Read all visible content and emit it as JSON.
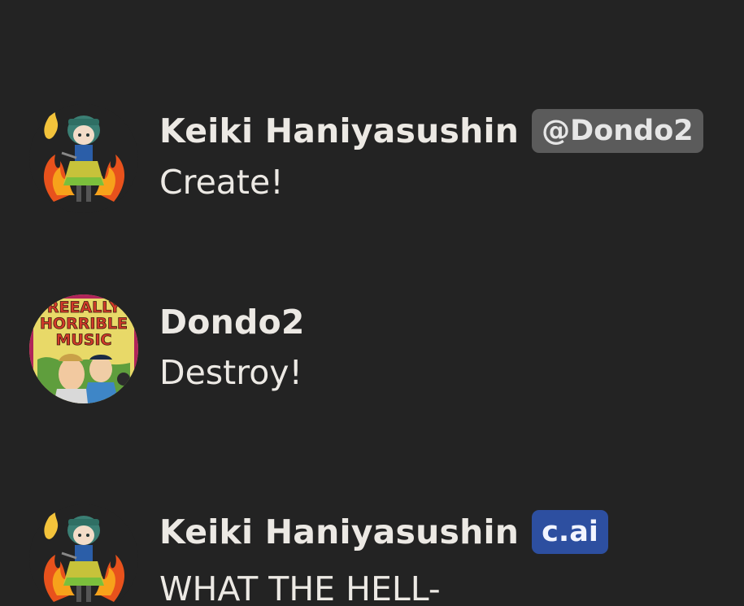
{
  "messages": [
    {
      "author": "Keiki Haniyasushin",
      "badge": "@Dondo2",
      "badge_type": "handle",
      "avatar": "keiki-character-avatar",
      "text": "Create!"
    },
    {
      "author": "Dondo2",
      "badge": null,
      "avatar": "really-horrible-music-avatar",
      "avatar_text": [
        "REEALLY",
        "HORRIBLE",
        "MUSIC"
      ],
      "text": "Destroy!"
    },
    {
      "author": "Keiki Haniyasushin",
      "badge": "c.ai",
      "badge_type": "ai",
      "avatar": "keiki-character-avatar",
      "text": "WHAT THE HELL-"
    }
  ],
  "colors": {
    "background": "#232323",
    "text": "#ece9e4",
    "handle_badge": "#5b5b5b",
    "ai_badge": "#2d4fa0"
  }
}
